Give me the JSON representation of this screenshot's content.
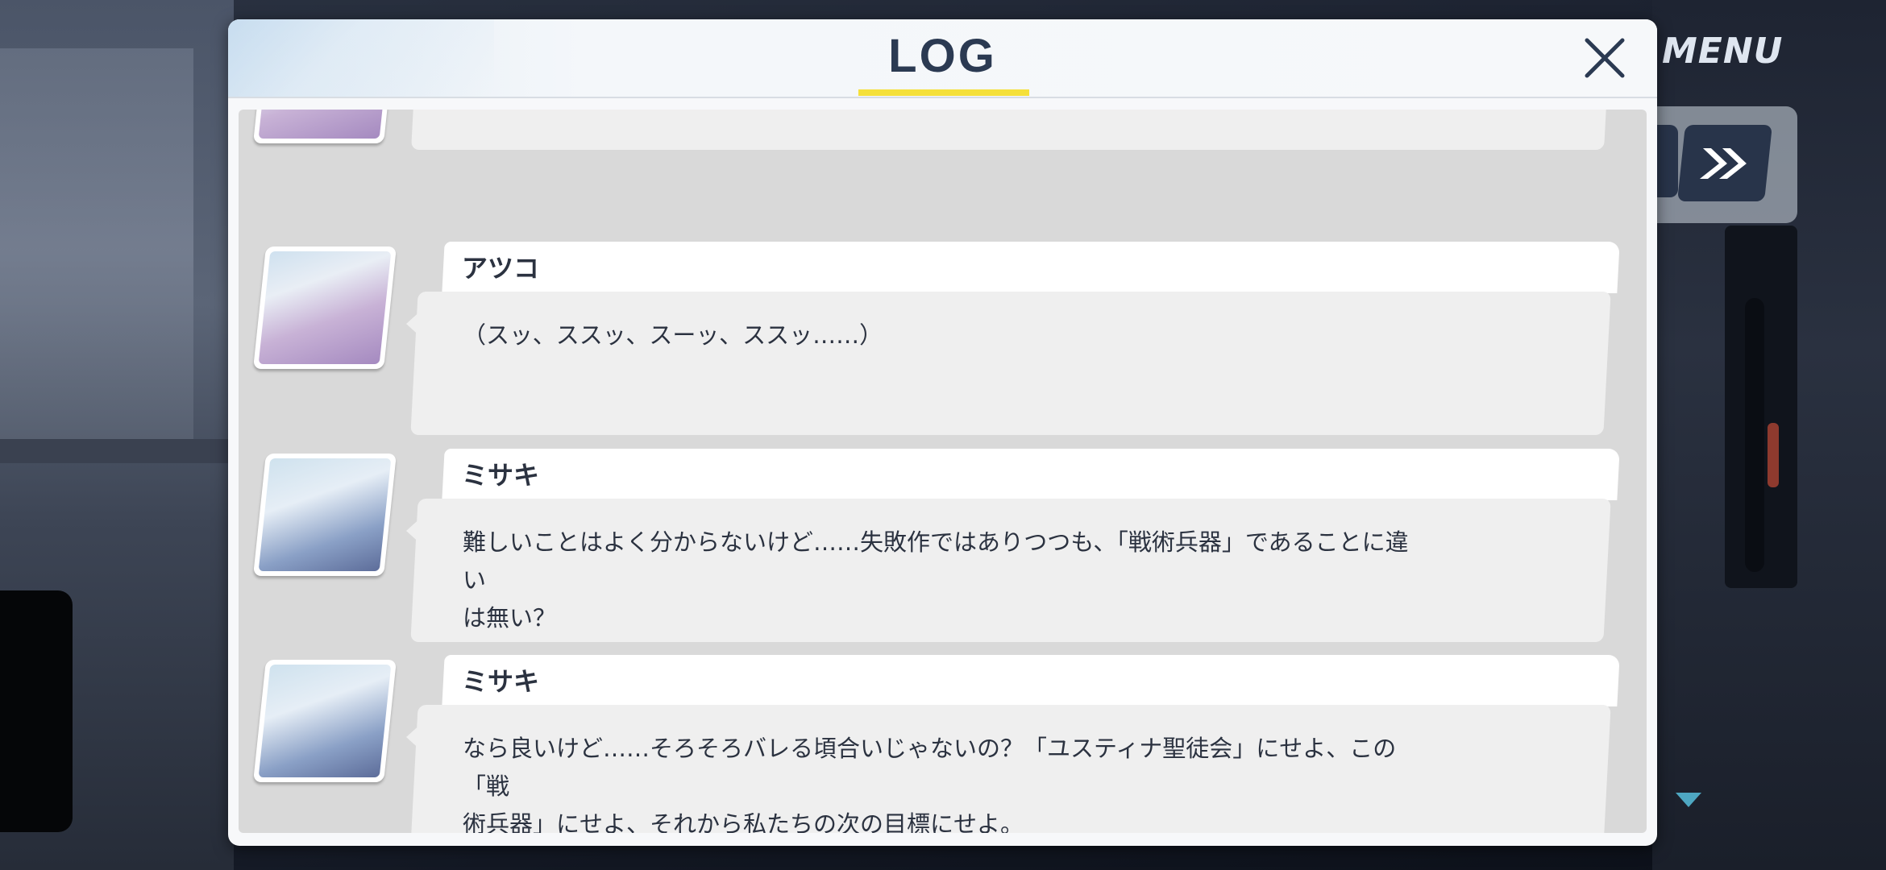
{
  "menu": {
    "label": "MENU"
  },
  "log": {
    "title": "LOG",
    "entries": [
      {
        "speaker": "",
        "avatar": "atsuko-avatar",
        "text": ""
      },
      {
        "speaker": "アツコ",
        "avatar": "atsuko-avatar",
        "text": "（スッ、ススッ、スーッ、ススッ……）"
      },
      {
        "speaker": "ミサキ",
        "avatar": "misaki-avatar",
        "text": "難しいことはよく分からないけど……失敗作ではありつつも、「戦術兵器」であることに違い\nは無い？"
      },
      {
        "speaker": "ミサキ",
        "avatar": "misaki-avatar",
        "text": "なら良いけど……そろそろバレる頃合いじゃないの？「ユスティナ聖徒会」にせよ、この「戦\n術兵器」にせよ、それから私たちの次の目標にせよ。"
      }
    ]
  },
  "icons": {
    "close": "close-icon",
    "fast_forward": "fast-forward-icon",
    "scroll_down": "triangle-down-icon"
  },
  "colors": {
    "title_text": "#2b3a52",
    "title_underline": "#f5e03a",
    "button_dark": "#28344a",
    "message_bg": "#efefef",
    "list_bg": "#d9d9d9"
  }
}
